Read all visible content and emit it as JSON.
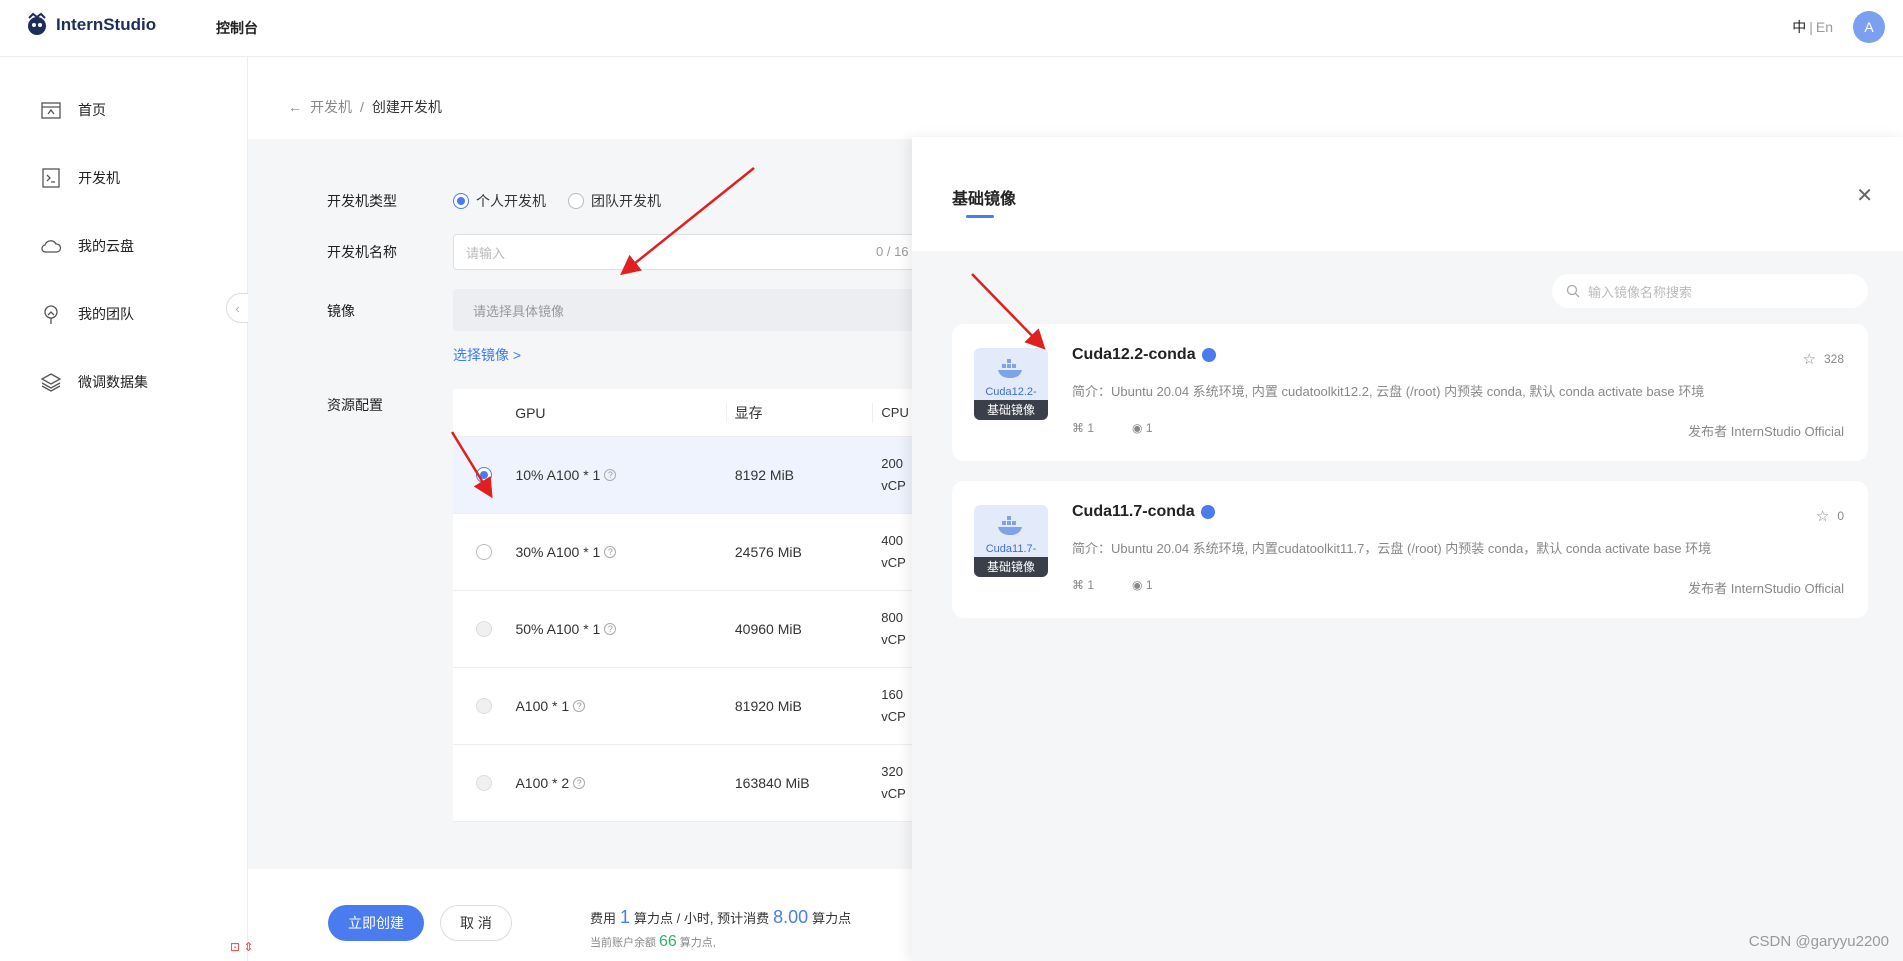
{
  "header": {
    "logo_text": "InternStudio",
    "console": "控制台",
    "lang_zh": "中",
    "lang_sep": "|",
    "lang_en": "En",
    "avatar": "A"
  },
  "sidebar": {
    "items": [
      {
        "label": "首页",
        "icon": "home-icon"
      },
      {
        "label": "开发机",
        "icon": "terminal-icon"
      },
      {
        "label": "我的云盘",
        "icon": "cloud-icon"
      },
      {
        "label": "我的团队",
        "icon": "team-icon"
      },
      {
        "label": "微调数据集",
        "icon": "layers-icon"
      }
    ],
    "collapse": "‹"
  },
  "breadcrumb": {
    "back": "←",
    "parent": "开发机",
    "sep": "/",
    "current": "创建开发机"
  },
  "form": {
    "type_label": "开发机类型",
    "type_personal": "个人开发机",
    "type_team": "团队开发机",
    "name_label": "开发机名称",
    "name_placeholder": "请输入",
    "name_counter": "0 / 16",
    "image_label": "镜像",
    "image_placeholder": "请选择具体镜像",
    "choose_image": "选择镜像 >",
    "resource_label": "资源配置"
  },
  "table": {
    "headers": [
      "GPU",
      "显存",
      "CPU"
    ],
    "rows": [
      {
        "gpu": "10% A100 * 1",
        "mem": "8192 MiB",
        "cpu1": "200",
        "cpu2": "vCP",
        "selected": true
      },
      {
        "gpu": "30% A100 * 1",
        "mem": "24576 MiB",
        "cpu1": "400",
        "cpu2": "vCP",
        "selected": false
      },
      {
        "gpu": "50% A100 * 1",
        "mem": "40960 MiB",
        "cpu1": "800",
        "cpu2": "vCP",
        "selected": false
      },
      {
        "gpu": "A100 * 1",
        "mem": "81920 MiB",
        "cpu1": "160",
        "cpu2": "vCP",
        "selected": false
      },
      {
        "gpu": "A100 * 2",
        "mem": "163840 MiB",
        "cpu1": "320",
        "cpu2": "vCP",
        "selected": false
      }
    ]
  },
  "footer": {
    "create": "立即创建",
    "cancel": "取 消",
    "cost_prefix": "费用",
    "cost_value": "1",
    "cost_mid": "算力点 / 小时, 预计消费",
    "cost_total": "8.00",
    "cost_suffix": "算力点",
    "balance_prefix": "当前账户余额",
    "balance_value": "66",
    "balance_suffix": "算力点,"
  },
  "drawer": {
    "title": "基础镜像",
    "close": "✕",
    "search_placeholder": "输入镜像名称搜索",
    "cards": [
      {
        "name": "Cuda12.2-conda",
        "thumb_ver": "Cuda12.2-",
        "thumb_tag": "基础镜像",
        "desc": "简介：Ubuntu 20.04 系统环境, 内置 cudatoolkit12.2, 云盘 (/root) 内预装 conda, 默认 conda activate base 环境",
        "forks": "1",
        "views": "1",
        "stars": "328",
        "publisher": "发布者  InternStudio Official"
      },
      {
        "name": "Cuda11.7-conda",
        "thumb_ver": "Cuda11.7-",
        "thumb_tag": "基础镜像",
        "desc": "简介：Ubuntu 20.04 系统环境, 内置cudatoolkit11.7，云盘 (/root) 内预装 conda，默认 conda activate base 环境",
        "forks": "1",
        "views": "1",
        "stars": "0",
        "publisher": "发布者  InternStudio Official"
      }
    ]
  },
  "watermark": "CSDN @garyyu2200",
  "accent": "#4a7cf0"
}
